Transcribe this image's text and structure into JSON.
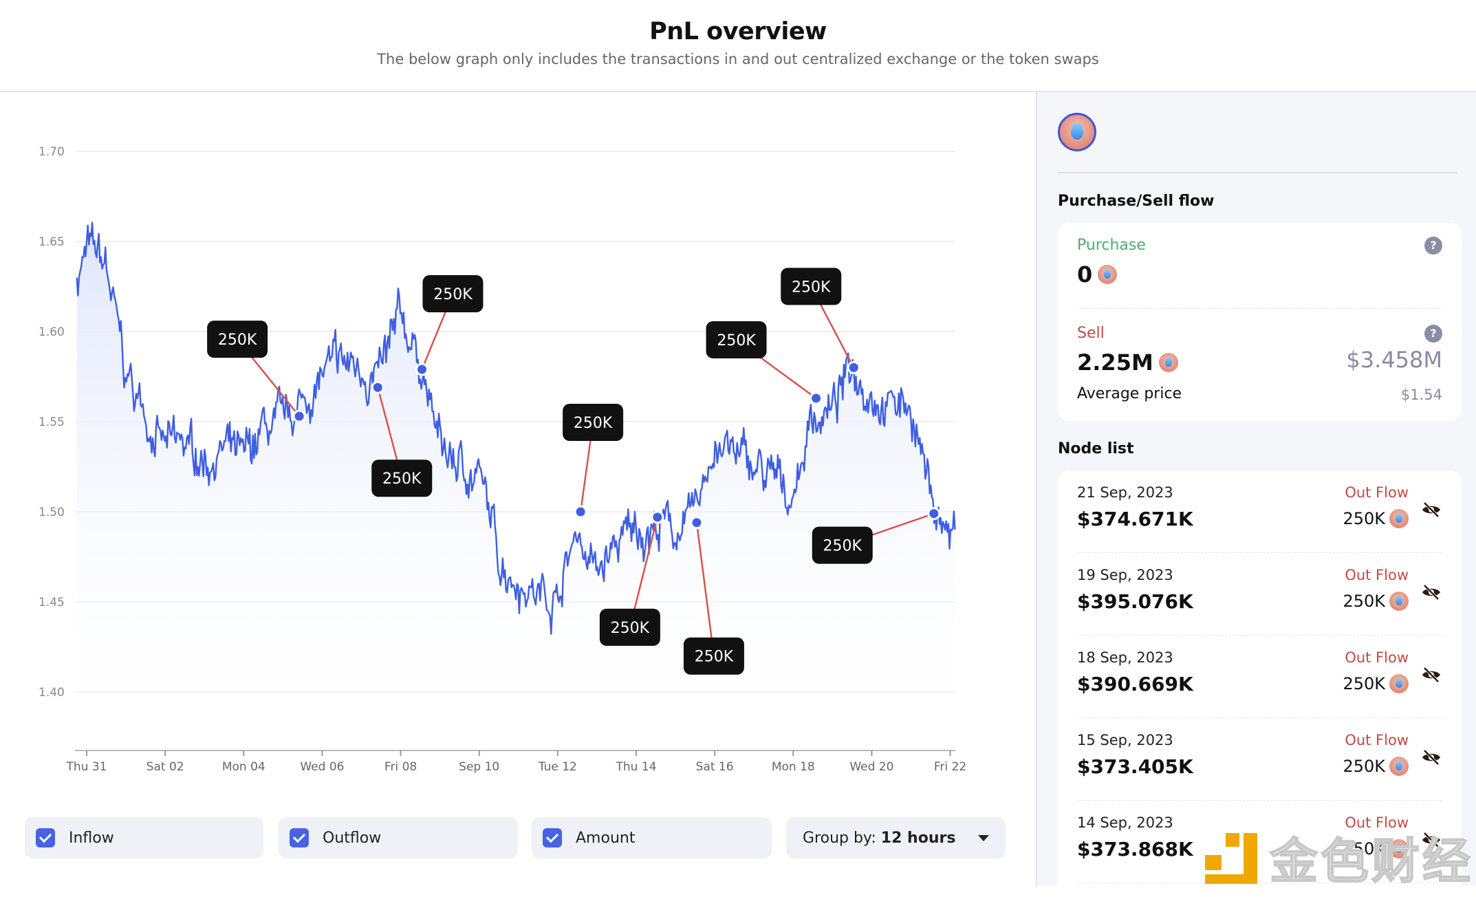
{
  "header": {
    "title": "PnL overview",
    "subtitle": "The below graph only includes the transactions in and out centralized exchange or the token swaps"
  },
  "chart_data": {
    "type": "line",
    "title": "",
    "xlabel": "",
    "ylabel": "",
    "ylim": [
      1.38,
      1.71
    ],
    "yticks": [
      "1.70",
      "1.65",
      "1.60",
      "1.55",
      "1.50",
      "1.45",
      "1.40"
    ],
    "xticks": [
      {
        "date": "2023-08-31",
        "label": "Thu 31"
      },
      {
        "date": "2023-09-02",
        "label": "Sat 02"
      },
      {
        "date": "2023-09-04",
        "label": "Mon 04"
      },
      {
        "date": "2023-09-06",
        "label": "Wed 06"
      },
      {
        "date": "2023-09-08",
        "label": "Fri 08"
      },
      {
        "date": "2023-09-10",
        "label": "Sep 10"
      },
      {
        "date": "2023-09-12",
        "label": "Tue 12"
      },
      {
        "date": "2023-09-14",
        "label": "Thu 14"
      },
      {
        "date": "2023-09-16",
        "label": "Sat 16"
      },
      {
        "date": "2023-09-18",
        "label": "Mon 18"
      },
      {
        "date": "2023-09-20",
        "label": "Wed 20"
      },
      {
        "date": "2023-09-22",
        "label": "Fri 22"
      }
    ],
    "grid": true,
    "line_color": "#3f5fe0",
    "series": [
      {
        "x": [
          "2023-08-30T18:00",
          "2023-08-31T00:00",
          "2023-08-31T12:00",
          "2023-09-01T00:00",
          "2023-09-01T12:00",
          "2023-09-02T00:00",
          "2023-09-02T12:00",
          "2023-09-03T00:00",
          "2023-09-03T12:00",
          "2023-09-04T00:00",
          "2023-09-04T12:00",
          "2023-09-05T00:00",
          "2023-09-05T12:00",
          "2023-09-06T00:00",
          "2023-09-06T12:00",
          "2023-09-07T00:00",
          "2023-09-07T12:00",
          "2023-09-08T00:00",
          "2023-09-08T12:00",
          "2023-09-09T00:00",
          "2023-09-09T12:00",
          "2023-09-10T00:00",
          "2023-09-10T12:00",
          "2023-09-11T00:00",
          "2023-09-11T12:00",
          "2023-09-12T00:00",
          "2023-09-12T12:00",
          "2023-09-13T00:00",
          "2023-09-13T12:00",
          "2023-09-14T00:00",
          "2023-09-14T12:00",
          "2023-09-15T00:00",
          "2023-09-15T12:00",
          "2023-09-16T00:00",
          "2023-09-16T12:00",
          "2023-09-17T00:00",
          "2023-09-17T12:00",
          "2023-09-18T00:00",
          "2023-09-18T12:00",
          "2023-09-19T00:00",
          "2023-09-19T12:00",
          "2023-09-20T00:00",
          "2023-09-20T12:00",
          "2023-09-21T00:00",
          "2023-09-21T12:00",
          "2023-09-22T00:00",
          "2023-09-22T03:00"
        ],
        "y": [
          1.63,
          1.645,
          1.635,
          1.575,
          1.555,
          1.535,
          1.535,
          1.53,
          1.535,
          1.525,
          1.545,
          1.545,
          1.56,
          1.575,
          1.58,
          1.58,
          1.575,
          1.605,
          1.585,
          1.535,
          1.525,
          1.52,
          1.475,
          1.465,
          1.455,
          1.455,
          1.49,
          1.465,
          1.48,
          1.49,
          1.492,
          1.49,
          1.495,
          1.54,
          1.53,
          1.525,
          1.515,
          1.51,
          1.555,
          1.555,
          1.58,
          1.57,
          1.56,
          1.56,
          1.51,
          1.485,
          1.49
        ]
      }
    ],
    "annotations": [
      {
        "date": "2023-09-05T10:00",
        "price": 1.553,
        "label": "250K"
      },
      {
        "date": "2023-09-07T10:00",
        "price": 1.569,
        "label": "250K"
      },
      {
        "date": "2023-09-08T13:00",
        "price": 1.579,
        "label": "250K"
      },
      {
        "date": "2023-09-12T14:00",
        "price": 1.5,
        "label": "250K"
      },
      {
        "date": "2023-09-14T13:00",
        "price": 1.497,
        "label": "250K"
      },
      {
        "date": "2023-09-15T13:00",
        "price": 1.494,
        "label": "250K"
      },
      {
        "date": "2023-09-18T14:00",
        "price": 1.563,
        "label": "250K"
      },
      {
        "date": "2023-09-19T13:00",
        "price": 1.58,
        "label": "250K"
      },
      {
        "date": "2023-09-21T14:00",
        "price": 1.499,
        "label": "250K"
      }
    ]
  },
  "controls": {
    "inflow": "Inflow",
    "outflow": "Outflow",
    "amount": "Amount",
    "group_prefix": "Group by: ",
    "group_value": "12 hours"
  },
  "panel": {
    "flow_title": "Purchase/Sell flow",
    "purchase_label": "Purchase",
    "purchase_value": "0",
    "sell_label": "Sell",
    "sell_value": "2.25M",
    "sell_usd": "$3.458M",
    "avg_label": "Average price",
    "avg_value": "$1.54",
    "help": "?",
    "node_title": "Node list",
    "nodes": [
      {
        "date": "21 Sep, 2023",
        "usd": "$374.671K",
        "type": "Out Flow",
        "qty": "250K"
      },
      {
        "date": "19 Sep, 2023",
        "usd": "$395.076K",
        "type": "Out Flow",
        "qty": "250K"
      },
      {
        "date": "18 Sep, 2023",
        "usd": "$390.669K",
        "type": "Out Flow",
        "qty": "250K"
      },
      {
        "date": "15 Sep, 2023",
        "usd": "$373.405K",
        "type": "Out Flow",
        "qty": "250K"
      },
      {
        "date": "14 Sep, 2023",
        "usd": "$373.868K",
        "type": "Out Flow",
        "qty": "250K"
      }
    ]
  },
  "colors": {
    "purchase": "#4cae6c",
    "sell": "#c24a44",
    "accent": "#4763e4",
    "connector": "#d9534f"
  },
  "watermark": "金色财经"
}
